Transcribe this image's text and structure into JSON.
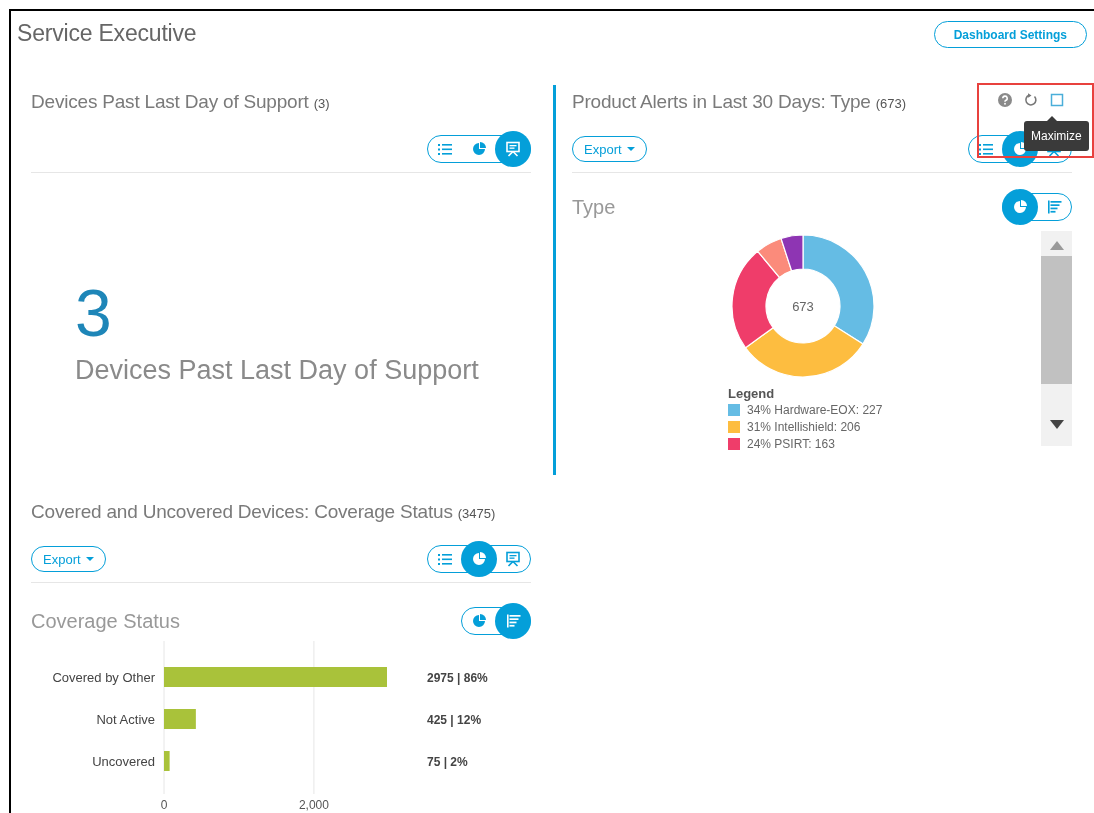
{
  "page": {
    "title": "Service Executive",
    "settings_button": "Dashboard Settings"
  },
  "panels": [
    {
      "kind": "big_number",
      "title": "Devices Past Last Day of Support",
      "count": "(3)",
      "toggle": [
        {
          "kind": "list",
          "selected": false
        },
        {
          "kind": "pie",
          "selected": false
        },
        {
          "kind": "presentation",
          "selected": true
        }
      ],
      "big_number": "3",
      "big_label": "Devices Past Last Day of Support"
    },
    {
      "kind": "donut",
      "title": "Product Alerts in Last 30 Days: Type",
      "count": "(673)",
      "export": "Export",
      "icons_highlighted": true,
      "tooltip": "Maximize",
      "toggle": [
        {
          "kind": "list",
          "selected": false
        },
        {
          "kind": "pie",
          "selected": true
        },
        {
          "kind": "presentation",
          "selected": false
        }
      ],
      "chart_title": "Type",
      "chart_toggle": [
        {
          "kind": "pie",
          "selected": true
        },
        {
          "kind": "bars",
          "selected": false
        }
      ],
      "center_label": "673",
      "legend_title": "Legend",
      "chart_data": {
        "type": "donut",
        "values": [
          34,
          31,
          24,
          6,
          5
        ],
        "colors": [
          "#65bce4",
          "#fdbd40",
          "#ef3d6a",
          "#fb8b7b",
          "#8e35b3"
        ]
      },
      "legend": [
        {
          "text": "34% Hardware-EOX: 227",
          "color": "#65bce4"
        },
        {
          "text": "31% Intellishield: 206",
          "color": "#fdbd40"
        },
        {
          "text": "24% PSIRT: 163",
          "color": "#ef3d6a"
        }
      ]
    },
    {
      "kind": "bar",
      "title": "Covered and Uncovered Devices: Coverage Status",
      "count": "(3475)",
      "export": "Export",
      "toggle": [
        {
          "kind": "list",
          "selected": false
        },
        {
          "kind": "pie",
          "selected": true
        },
        {
          "kind": "presentation",
          "selected": false
        }
      ],
      "chart_title": "Coverage Status",
      "chart_toggle": [
        {
          "kind": "pie",
          "selected": false
        },
        {
          "kind": "bars",
          "selected": true
        }
      ],
      "chart_data": {
        "type": "bar",
        "orientation": "horizontal",
        "categories": [
          "Covered by Other",
          "Not Active",
          "Uncovered"
        ],
        "series": [
          {
            "color": "#a9c23a",
            "values": [
              2975,
              425,
              75
            ]
          }
        ],
        "xlim": [
          0,
          2975
        ],
        "xticks": [
          0,
          {
            "value": 2000,
            "label": "2,000"
          }
        ],
        "value_labels": [
          "2975 | 86%",
          "425 | 12%",
          "75 | 2%"
        ]
      }
    }
  ]
}
